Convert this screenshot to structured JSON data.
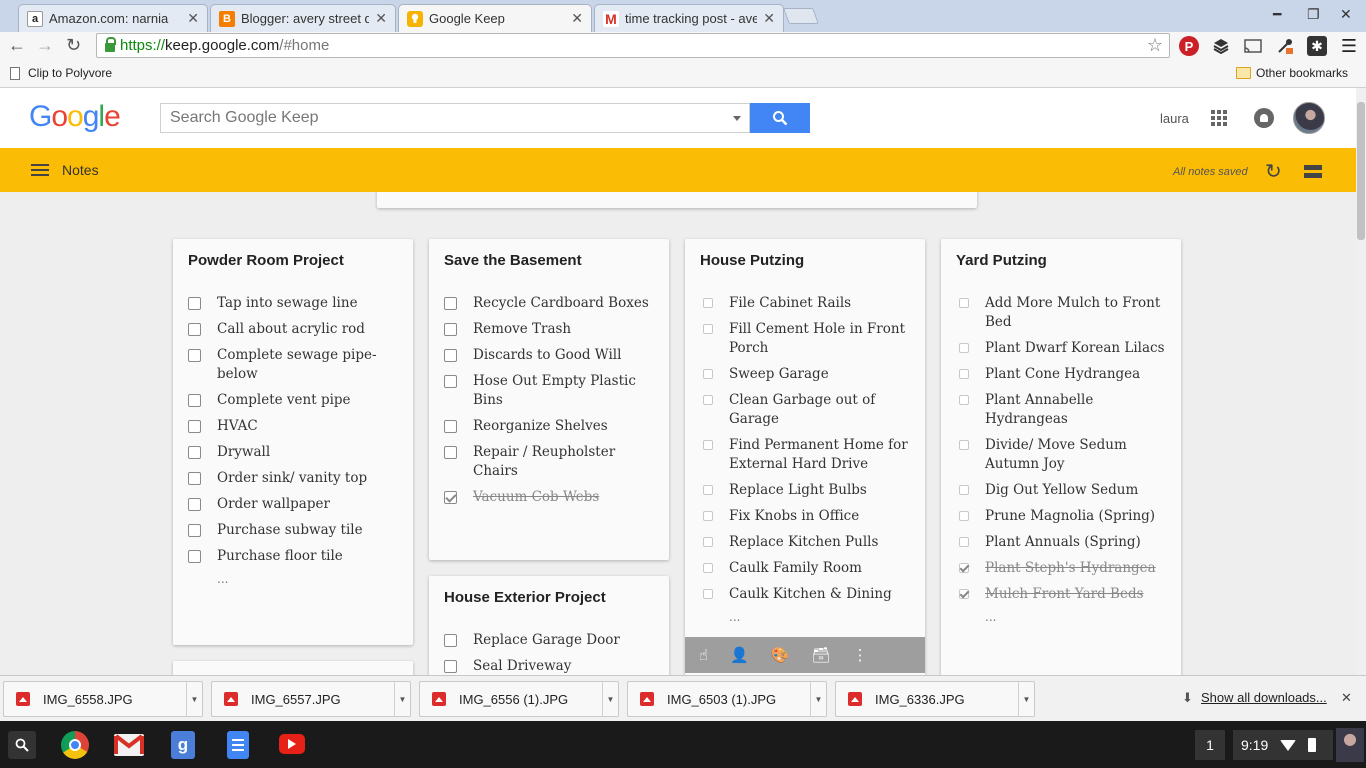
{
  "browser": {
    "tabs": [
      {
        "title": "Amazon.com: narnia",
        "favicon": "a",
        "favicon_color": "#222222",
        "active": false
      },
      {
        "title": "Blogger: avery street design",
        "favicon": "B",
        "favicon_color": "#f57d00",
        "active": false
      },
      {
        "title": "Google Keep",
        "favicon": "bulb",
        "favicon_color": "#f6b400",
        "active": true
      },
      {
        "title": "time tracking post - avery",
        "favicon": "M",
        "favicon_color": "#d93025",
        "active": false
      }
    ],
    "url_https": "https://",
    "url_host": "keep.google.com",
    "url_path": "/#home",
    "bookmarks": {
      "left": "Clip to Polyvore",
      "right": "Other bookmarks"
    }
  },
  "keep": {
    "logo": "Google",
    "search_placeholder": "Search Google Keep",
    "user_name": "laura",
    "section_title": "Notes",
    "save_status": "All notes saved"
  },
  "notes": [
    {
      "title": "Powder Room Project",
      "items": [
        {
          "text": "Tap into sewage line",
          "checked": false
        },
        {
          "text": "Call about acrylic rod",
          "checked": false
        },
        {
          "text": "Complete sewage pipe- below",
          "checked": false
        },
        {
          "text": "Complete vent pipe",
          "checked": false
        },
        {
          "text": "HVAC",
          "checked": false
        },
        {
          "text": "Drywall",
          "checked": false
        },
        {
          "text": "Order sink/ vanity top",
          "checked": false
        },
        {
          "text": "Order wallpaper",
          "checked": false
        },
        {
          "text": "Purchase subway tile",
          "checked": false
        },
        {
          "text": "Purchase floor tile",
          "checked": false
        }
      ],
      "more": "..."
    },
    {
      "title": "Save the Basement",
      "items": [
        {
          "text": "Recycle Cardboard Boxes",
          "checked": false
        },
        {
          "text": "Remove Trash",
          "checked": false
        },
        {
          "text": "Discards to Good Will",
          "checked": false
        },
        {
          "text": "Hose Out Empty Plastic Bins",
          "checked": false
        },
        {
          "text": "Reorganize Shelves",
          "checked": false
        },
        {
          "text": "Repair / Reupholster Chairs",
          "checked": false
        },
        {
          "text": "Vacuum Cob Webs",
          "checked": true
        }
      ]
    },
    {
      "title": "House Putzing",
      "items": [
        {
          "text": "File Cabinet Rails",
          "checked": false
        },
        {
          "text": "Fill Cement Hole in Front Porch",
          "checked": false
        },
        {
          "text": "Sweep Garage",
          "checked": false
        },
        {
          "text": "Clean Garbage out of Garage",
          "checked": false
        },
        {
          "text": "Find Permanent Home for External Hard Drive",
          "checked": false
        },
        {
          "text": "Replace Light Bulbs",
          "checked": false
        },
        {
          "text": "Fix Knobs in Office",
          "checked": false
        },
        {
          "text": "Replace Kitchen Pulls",
          "checked": false
        },
        {
          "text": "Caulk Family Room",
          "checked": false
        },
        {
          "text": "Caulk Kitchen & Dining",
          "checked": false
        }
      ],
      "more": "..."
    },
    {
      "title": "Yard Putzing",
      "items": [
        {
          "text": "Add More Mulch to Front Bed",
          "checked": false
        },
        {
          "text": "Plant Dwarf Korean Lilacs",
          "checked": false
        },
        {
          "text": "Plant Cone Hydrangea",
          "checked": false
        },
        {
          "text": "Plant Annabelle Hydrangeas",
          "checked": false
        },
        {
          "text": "Divide/ Move Sedum Autumn Joy",
          "checked": false
        },
        {
          "text": "Dig Out Yellow Sedum",
          "checked": false
        },
        {
          "text": "Prune Magnolia (Spring)",
          "checked": false
        },
        {
          "text": "Plant Annuals (Spring)",
          "checked": false
        },
        {
          "text": "Plant Steph's Hydrangea",
          "checked": true
        },
        {
          "text": "Mulch Front Yard Beds",
          "checked": true
        }
      ],
      "more": "..."
    },
    {
      "title": "House Exterior Project",
      "items": [
        {
          "text": "Replace Garage Door",
          "checked": false
        },
        {
          "text": "Seal Driveway",
          "checked": false
        }
      ]
    }
  ],
  "downloads": {
    "files": [
      "IMG_6558.JPG",
      "IMG_6557.JPG",
      "IMG_6556 (1).JPG",
      "IMG_6503 (1).JPG",
      "IMG_6336.JPG"
    ],
    "show_all": "Show all downloads..."
  },
  "taskbar": {
    "badge": "1",
    "time": "9:19"
  }
}
